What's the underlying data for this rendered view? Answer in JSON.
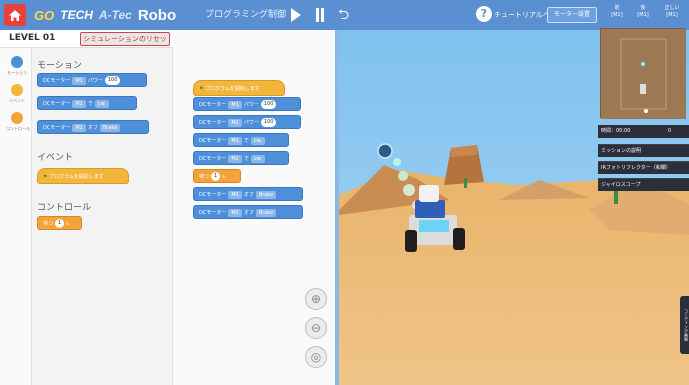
{
  "app": {
    "brand_go": "GO",
    "brand_tech": "TECH",
    "brand_atec": "A-Tec",
    "brand_robo": "Robo",
    "program_title": "プログラミング制御",
    "tutorial": "チュートリアルへ",
    "motor_settings": "モーター設置",
    "cam_labels": [
      "前\n[M2]",
      "後\n[M1]",
      "正しい\n[M1]"
    ]
  },
  "level": "LEVEL 01",
  "reset_button": "シミュレーションのリセッ",
  "categories": [
    {
      "label": "モーション",
      "color": "#4d90d9"
    },
    {
      "label": "イベント",
      "color": "#f4b53c"
    },
    {
      "label": "コントロール",
      "color": "#f3a33a"
    }
  ],
  "palette": {
    "motion_heading": "モーション",
    "event_heading": "イベント",
    "control_heading": "コントロール",
    "blocks": {
      "motor_power": {
        "text": "DCモーター",
        "port": "M1",
        "mid": "パワー",
        "value": "100"
      },
      "motor_dir": {
        "text": "DCモーター",
        "port": "M1",
        "mid": "で",
        "value": "cw."
      },
      "motor_off": {
        "text": "DCモーター",
        "port": "M1",
        "mid": "オフ",
        "value": "Brake"
      },
      "start": {
        "text": "プログラムを開始します"
      },
      "wait": {
        "text": "待つ",
        "value": "1",
        "unit": "s"
      }
    }
  },
  "workspace": {
    "start": "プログラムを開始します",
    "rows": [
      {
        "text": "DCモーター",
        "port": "M1",
        "mid": "パワー",
        "value": "100"
      },
      {
        "text": "DCモーター",
        "port": "M2",
        "mid": "パワー",
        "value": "100"
      },
      {
        "text": "DCモーター",
        "port": "M1",
        "mid": "で",
        "value": "cw."
      },
      {
        "text": "DCモーター",
        "port": "M2",
        "mid": "で",
        "value": "cw."
      }
    ],
    "wait": {
      "text": "待つ",
      "value": "1",
      "unit": "s"
    },
    "offs": [
      {
        "text": "DCモーター",
        "port": "M1",
        "mid": "オフ",
        "value": "Brake"
      },
      {
        "text": "DCモーター",
        "port": "M2",
        "mid": "オフ",
        "value": "Brake"
      }
    ]
  },
  "scene": {
    "timer_label": "時間：00:00",
    "timer_value": "0",
    "missions": [
      "ミッションの説明",
      "IRフォトリフレクター（和欄）",
      "ジャイロスコープ"
    ],
    "side_tab": "コーディング画面"
  }
}
